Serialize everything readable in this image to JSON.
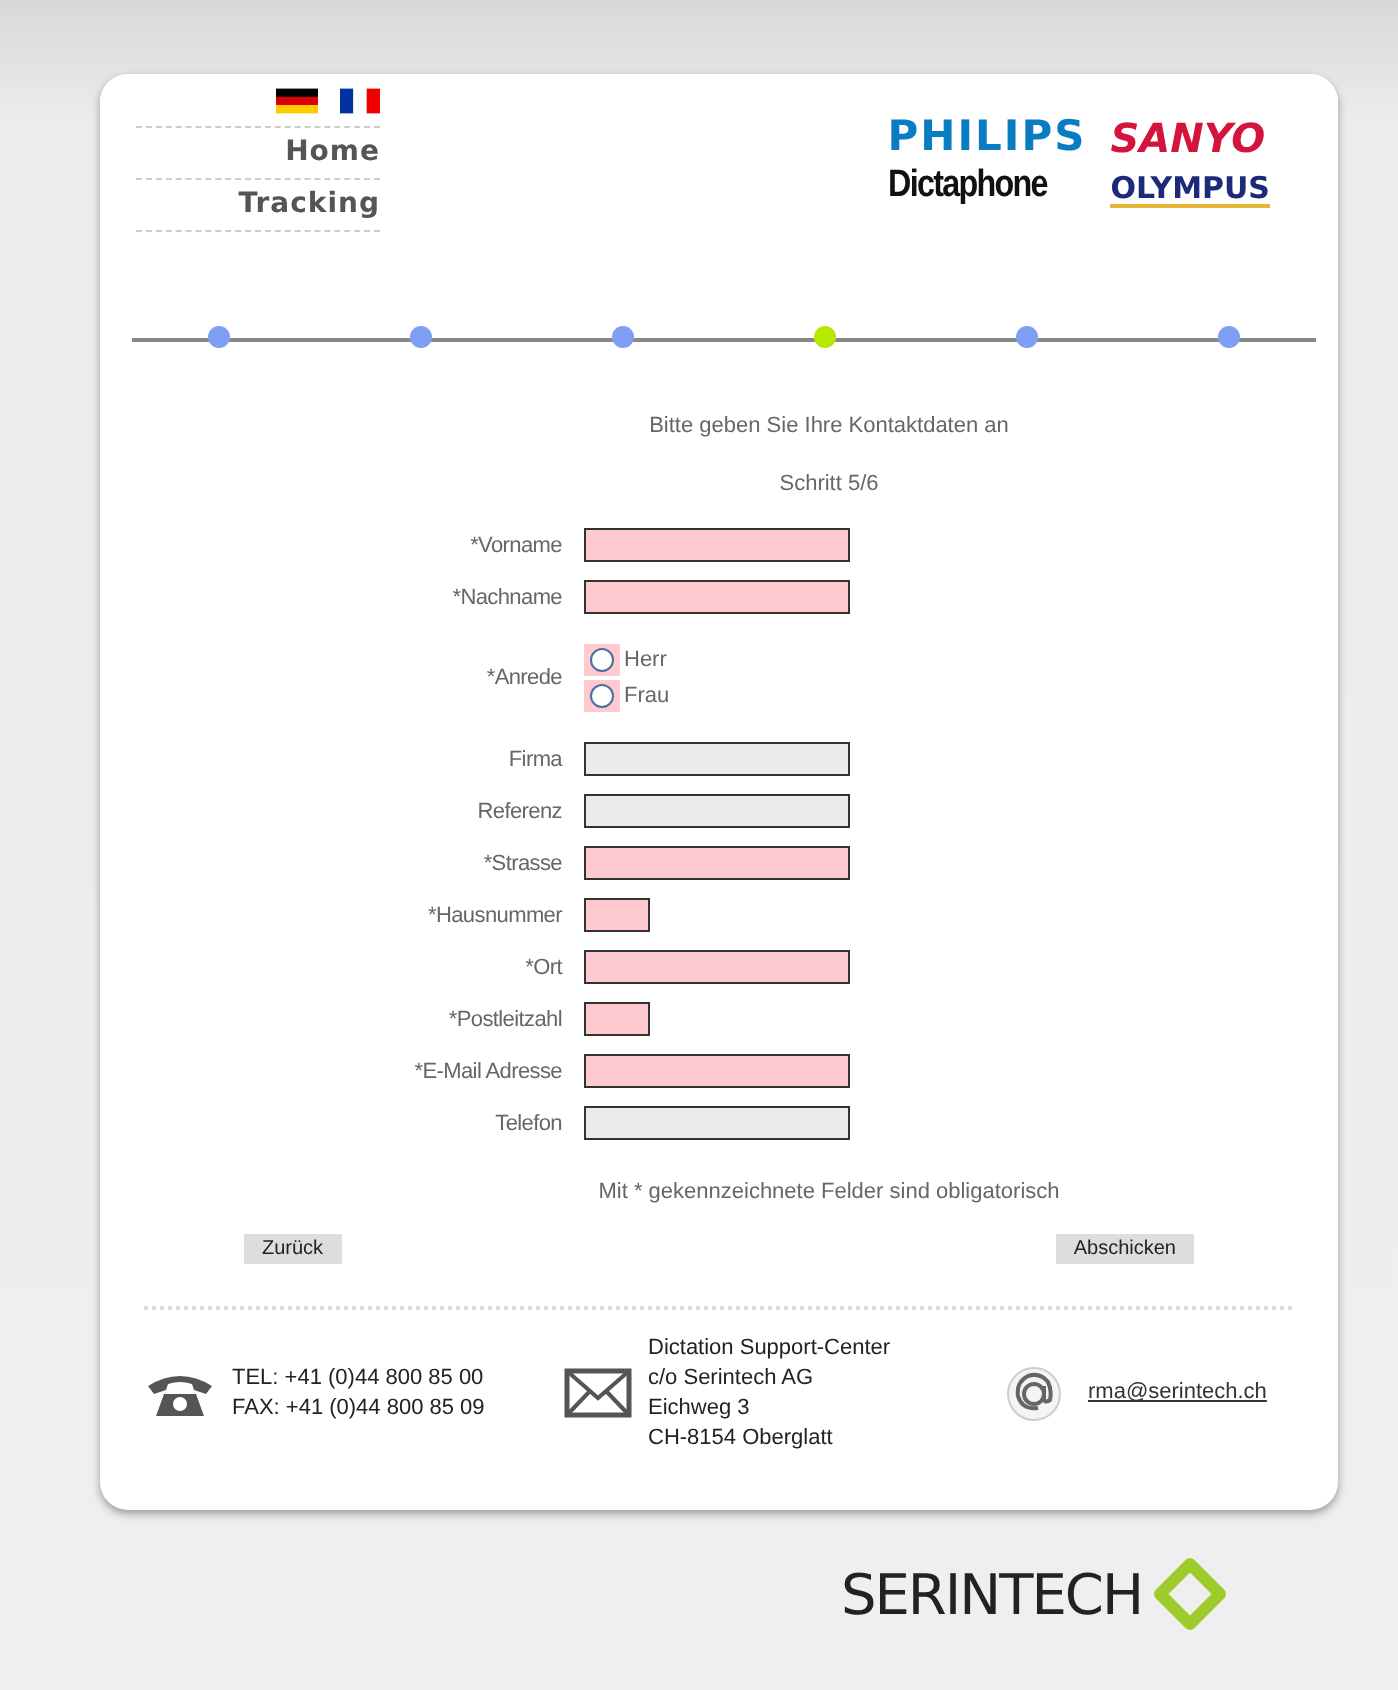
{
  "languages": [
    {
      "kind": "de"
    },
    {
      "kind": "fr"
    }
  ],
  "nav": [
    "Home",
    "Tracking"
  ],
  "brands": [
    {
      "kind": "philips",
      "text": "PHILIPS"
    },
    {
      "kind": "sanyo",
      "text": "SANYO"
    },
    {
      "kind": "dictaphone",
      "text": "Dictaphone"
    },
    {
      "kind": "olympus",
      "text": "OLYMPUS"
    }
  ],
  "steps": [
    {
      "selected": false
    },
    {
      "selected": false
    },
    {
      "selected": false
    },
    {
      "selected": true
    },
    {
      "selected": false
    },
    {
      "selected": false
    }
  ],
  "form": {
    "title": "Bitte geben Sie Ihre Kontaktdaten an",
    "step": "Schritt 5/6",
    "fields": [
      {
        "label": "*Vorname",
        "kind": "text",
        "required": true
      },
      {
        "label": "*Nachname",
        "kind": "text",
        "required": true
      },
      {
        "label": "*Anrede",
        "kind": "radio",
        "required": true,
        "options": [
          {
            "label": "Herr",
            "selected": false
          },
          {
            "label": "Frau",
            "selected": false
          }
        ]
      },
      {
        "label": "Firma",
        "kind": "text",
        "required": false
      },
      {
        "label": "Referenz",
        "kind": "text",
        "required": false
      },
      {
        "label": "*Strasse",
        "kind": "text",
        "required": true
      },
      {
        "label": "*Hausnummer",
        "kind": "short",
        "required": true
      },
      {
        "label": "*Ort",
        "kind": "text",
        "required": true
      },
      {
        "label": "*Postleitzahl",
        "kind": "short",
        "required": true
      },
      {
        "label": "*E-Mail Adresse",
        "kind": "text",
        "required": true
      },
      {
        "label": "Telefon",
        "kind": "text",
        "required": false
      }
    ],
    "note": "Mit * gekennzeichnete Felder sind obligatorisch",
    "buttons": [
      "Zurück",
      "Abschicken"
    ]
  },
  "footer": {
    "phone": [
      "TEL: +41 (0)44 800 85 00",
      "FAX: +41 (0)44 800 85 09"
    ],
    "address": [
      "Dictation Support-Center",
      "c/o Serintech AG",
      "Eichweg 3",
      "CH-8154 Oberglatt"
    ],
    "email": "rma@serintech.ch"
  },
  "company_logo": "SERINTECH"
}
